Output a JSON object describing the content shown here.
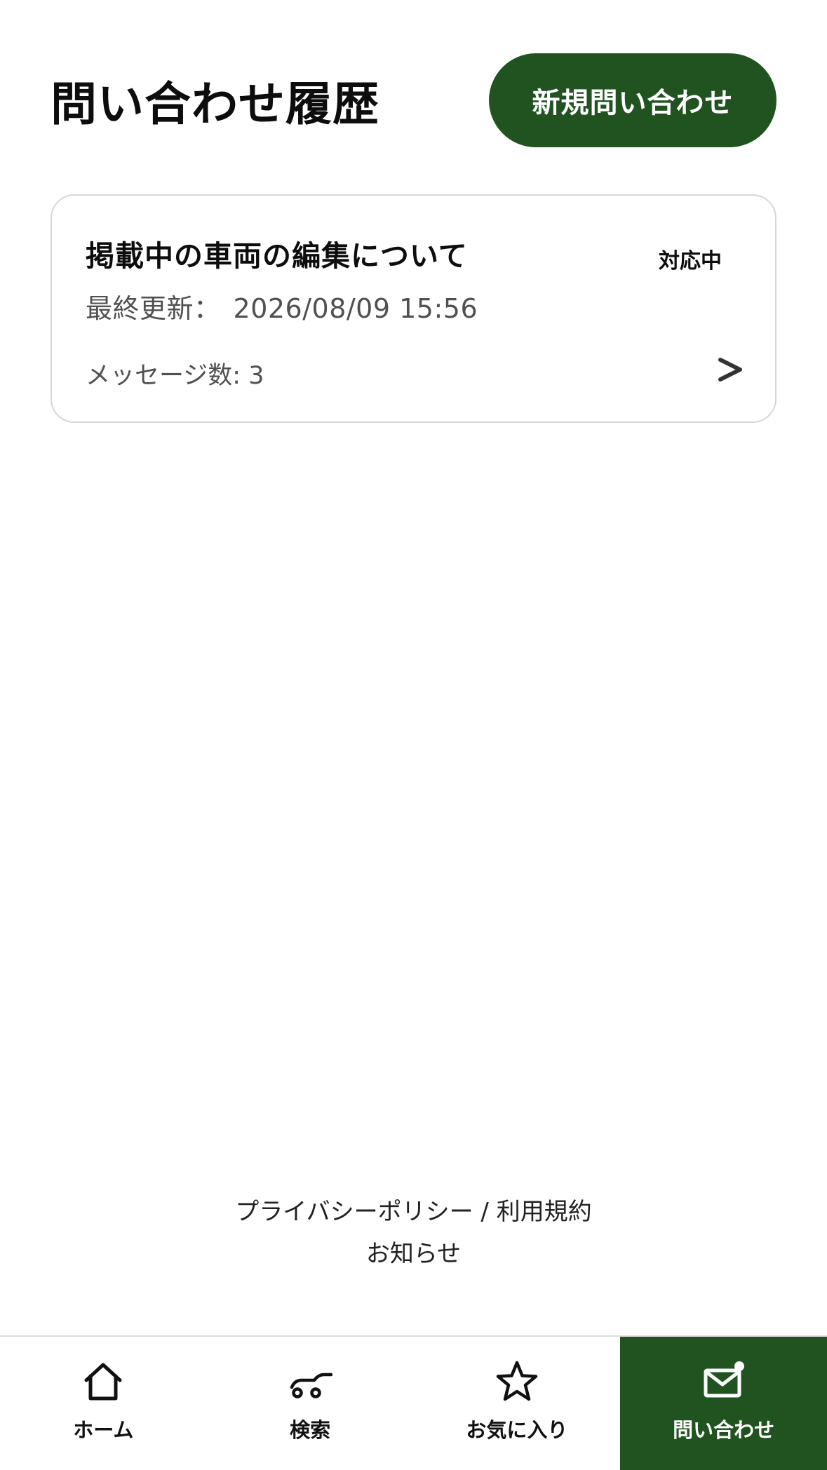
{
  "header": {
    "title": "問い合わせ履歴",
    "new_inquiry_label": "新規問い合わせ"
  },
  "inquiries": [
    {
      "title": "掲載中の車両の編集について",
      "status": "対応中",
      "updated_label": "最終更新：",
      "updated_value": "2026/08/09 15:56",
      "message_count": "メッセージ数: 3",
      "chevron": ">"
    }
  ],
  "footer": {
    "privacy_policy": "プライバシーポリシー",
    "separator": " / ",
    "terms": "利用規約",
    "news": "お知らせ"
  },
  "bottom_nav": {
    "items": [
      {
        "label": "ホーム",
        "icon": "home-icon"
      },
      {
        "label": "検索",
        "icon": "car-search-icon"
      },
      {
        "label": "お気に入り",
        "icon": "star-icon"
      },
      {
        "label": "問い合わせ",
        "icon": "mail-notification-icon",
        "active": true
      }
    ]
  },
  "colors": {
    "accent": "#215321",
    "card_border": "#d6d6d6",
    "muted_text": "#505050"
  }
}
